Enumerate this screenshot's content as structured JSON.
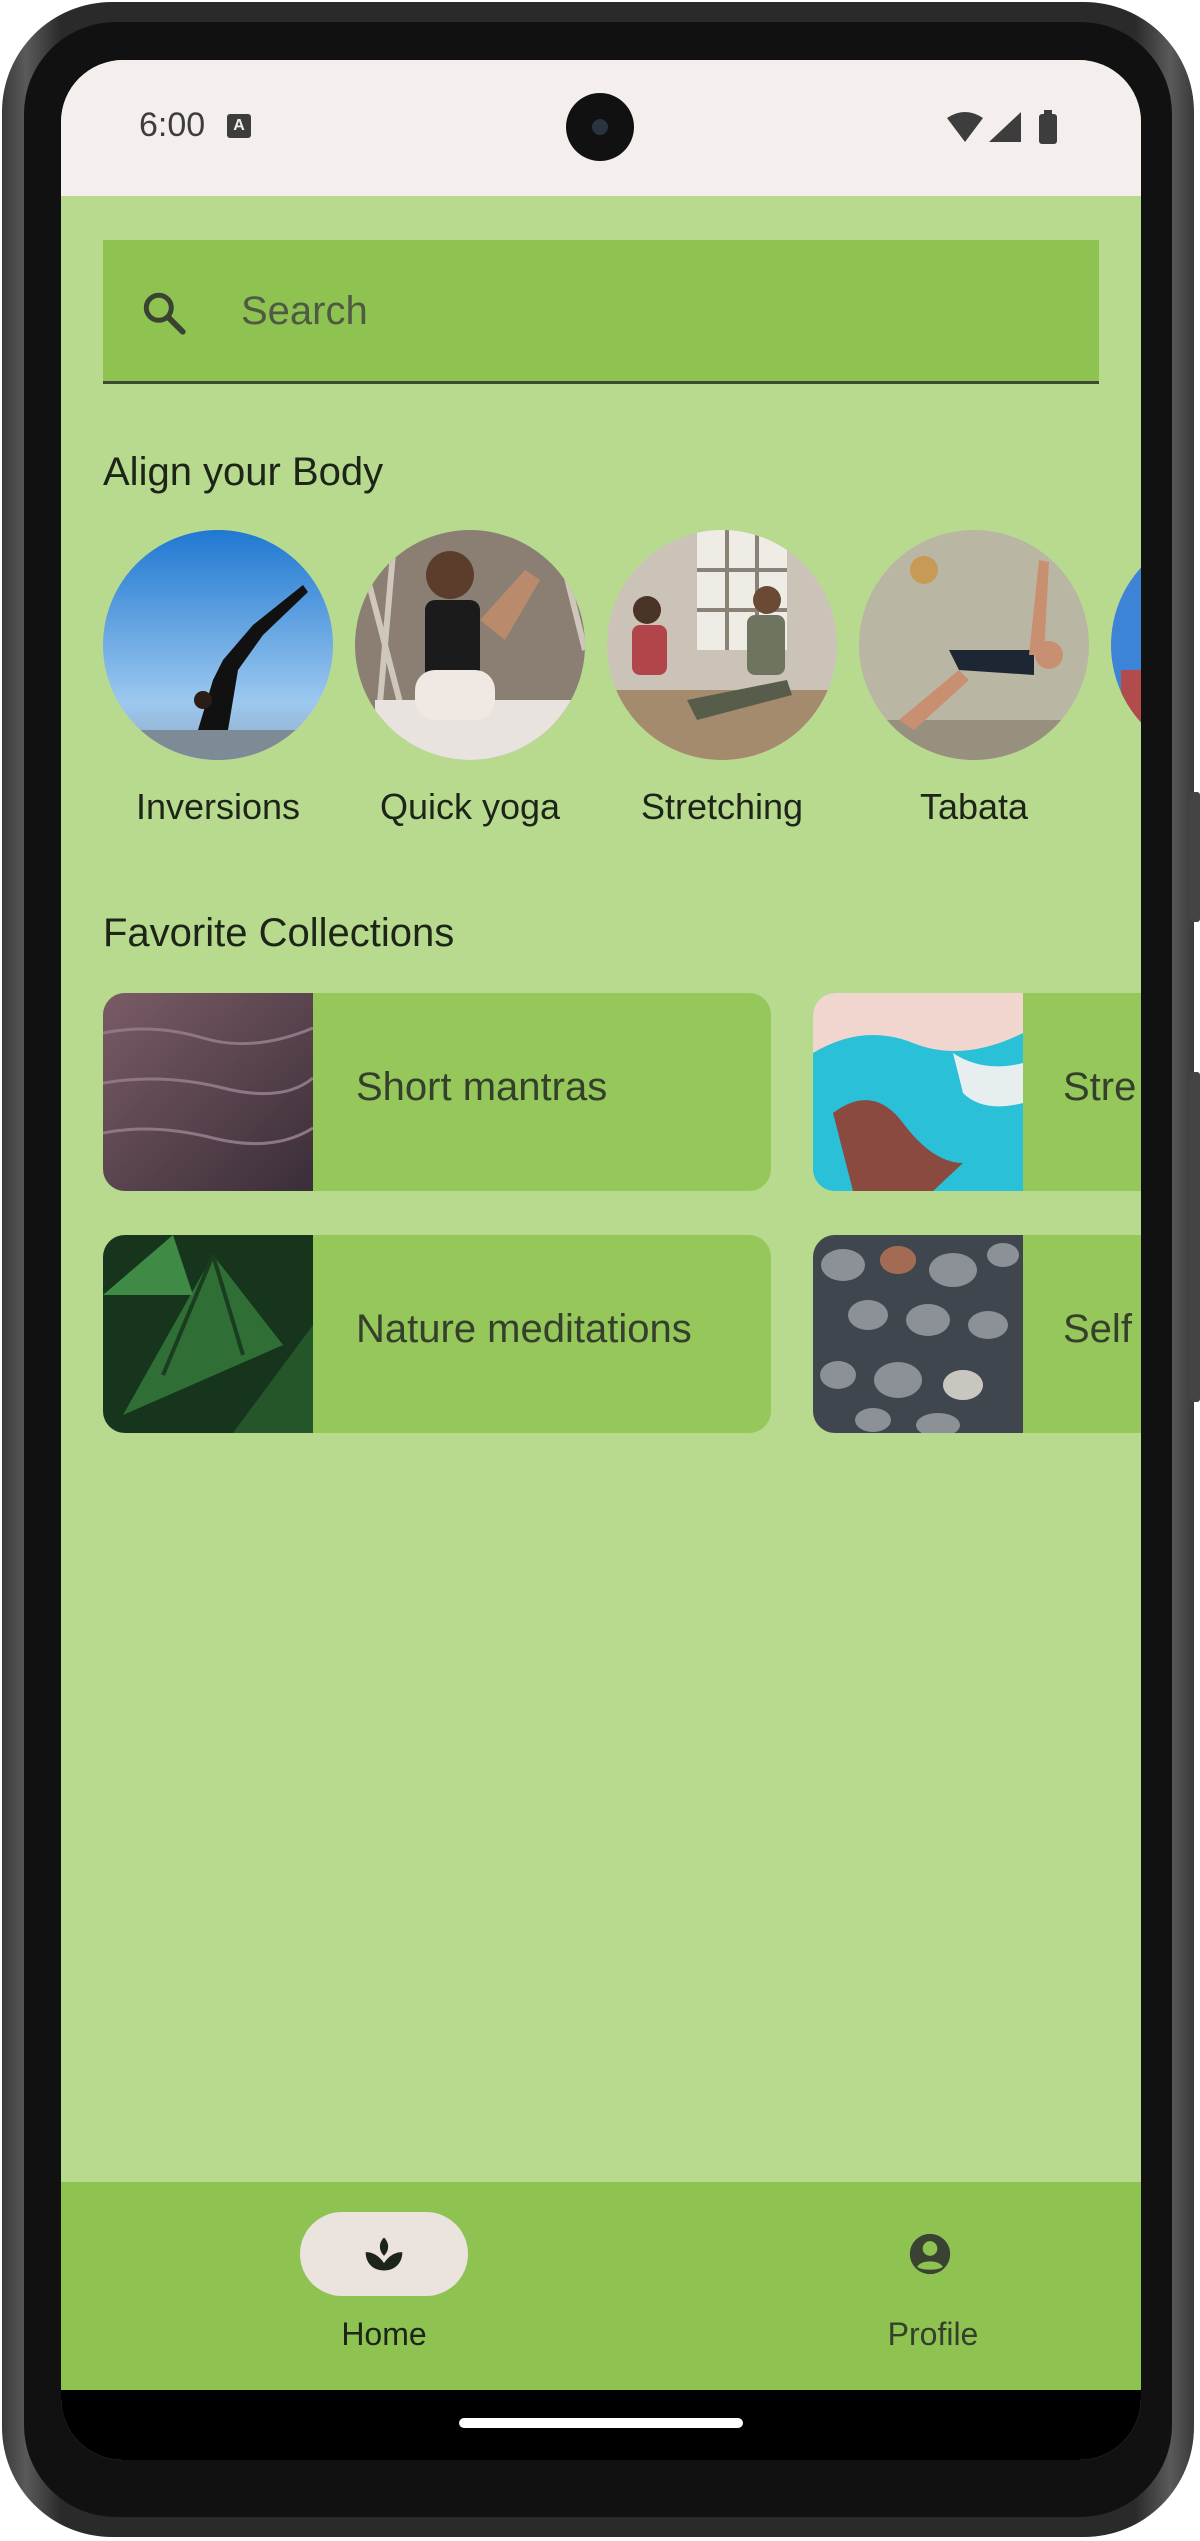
{
  "status_bar": {
    "time": "6:00",
    "notification_badge": "A"
  },
  "search": {
    "placeholder": "Search",
    "icon": "search-icon"
  },
  "align_body": {
    "title": "Align your Body",
    "items": [
      {
        "label": "Inversions"
      },
      {
        "label": "Quick yoga"
      },
      {
        "label": "Stretching"
      },
      {
        "label": "Tabata"
      },
      {
        "label": ""
      }
    ]
  },
  "favorite_collections": {
    "title": "Favorite Collections",
    "items": [
      {
        "label": "Short mantras"
      },
      {
        "label": "Stre"
      },
      {
        "label": "Nature meditations"
      },
      {
        "label": "Self"
      }
    ]
  },
  "bottom_nav": {
    "items": [
      {
        "label": "Home",
        "icon": "spa-icon",
        "selected": true
      },
      {
        "label": "Profile",
        "icon": "account-circle-icon",
        "selected": false
      }
    ]
  },
  "colors": {
    "background": "#b8da8f",
    "surface": "#8fc351",
    "card": "#95c75b",
    "nav_indicator": "#ebe4de",
    "status_bar": "#f4efec"
  }
}
